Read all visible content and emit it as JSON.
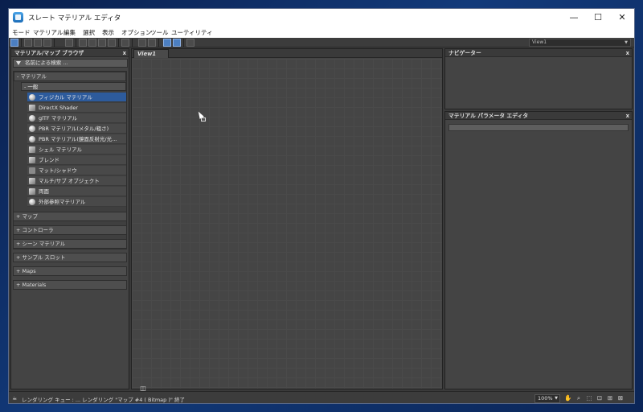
{
  "window": {
    "title": "スレート マテリアル エディタ",
    "minimize": "—",
    "maximize": "☐",
    "close": "✕"
  },
  "menu": [
    "モード",
    "マテリアル",
    "編集",
    "選択",
    "表示",
    "オプション",
    "ツール",
    "ユーティリティ"
  ],
  "toolbar": {
    "view_select": "View1"
  },
  "browser": {
    "title": "マテリアル/マップ ブラウザ",
    "close": "x",
    "search_placeholder": "名前による検索 ...",
    "materials_group": "- マテリアル",
    "general_sub": "- 一般",
    "items": [
      {
        "label": "フィジカル マテリアル",
        "selected": true,
        "swatch": "sphere"
      },
      {
        "label": "DirectX Shader",
        "selected": false,
        "swatch": "square"
      },
      {
        "label": "glTF マテリアル",
        "selected": false,
        "swatch": "sphere"
      },
      {
        "label": "PBR マテリアル(メタル/粗さ)",
        "selected": false,
        "swatch": "sphere"
      },
      {
        "label": "PBR マテリアル(鏡面反射光/光...",
        "selected": false,
        "swatch": "sphere"
      },
      {
        "label": "シェル マテリアル",
        "selected": false,
        "swatch": "square"
      },
      {
        "label": "ブレンド",
        "selected": false,
        "swatch": "square"
      },
      {
        "label": "マット/シャドウ",
        "selected": false,
        "swatch": "flat"
      },
      {
        "label": "マルチ/サブ オブジェクト",
        "selected": false,
        "swatch": "square"
      },
      {
        "label": "両面",
        "selected": false,
        "swatch": "square"
      },
      {
        "label": "外部参照マテリアル",
        "selected": false,
        "swatch": "sphere"
      }
    ],
    "rollouts": [
      "+ マップ",
      "+ コントローラ",
      "+ シーン マテリアル",
      "+ サンプル スロット",
      "+ Maps",
      "+ Materials"
    ]
  },
  "view": {
    "tab": "View1"
  },
  "navigator": {
    "title": "ナビゲーター",
    "close": "x"
  },
  "params": {
    "title": "マテリアル パラメータ エディタ",
    "close": "x"
  },
  "status": {
    "text": "レンダリング キュー : ... レンダリング \"マップ #4 ( Bitmap )\" 終了",
    "zoom": "100%"
  }
}
